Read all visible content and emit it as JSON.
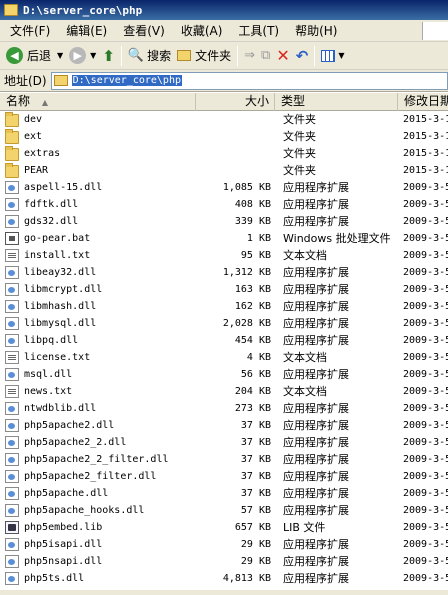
{
  "window": {
    "title": "D:\\server_core\\php"
  },
  "menu": [
    {
      "label": "文件(F)",
      "name": "menu-file"
    },
    {
      "label": "编辑(E)",
      "name": "menu-edit"
    },
    {
      "label": "查看(V)",
      "name": "menu-view"
    },
    {
      "label": "收藏(A)",
      "name": "menu-favorites"
    },
    {
      "label": "工具(T)",
      "name": "menu-tools"
    },
    {
      "label": "帮助(H)",
      "name": "menu-help"
    }
  ],
  "toolbar": {
    "back_label": "后退",
    "search_label": "搜索",
    "folders_label": "文件夹"
  },
  "address": {
    "label": "地址(D)",
    "value": "D:\\server_core\\php"
  },
  "columns": {
    "name": "名称",
    "size": "大小",
    "type": "类型",
    "modified": "修改日期"
  },
  "files": [
    {
      "name": "dev",
      "size": "",
      "type": "文件夹",
      "date": "2015-3-1",
      "icon": "folder"
    },
    {
      "name": "ext",
      "size": "",
      "type": "文件夹",
      "date": "2015-3-1",
      "icon": "folder"
    },
    {
      "name": "extras",
      "size": "",
      "type": "文件夹",
      "date": "2015-3-1",
      "icon": "folder"
    },
    {
      "name": "PEAR",
      "size": "",
      "type": "文件夹",
      "date": "2015-3-1",
      "icon": "folder"
    },
    {
      "name": "aspell-15.dll",
      "size": "1,085 KB",
      "type": "应用程序扩展",
      "date": "2009-3-5",
      "icon": "dll"
    },
    {
      "name": "fdftk.dll",
      "size": "408 KB",
      "type": "应用程序扩展",
      "date": "2009-3-5",
      "icon": "dll"
    },
    {
      "name": "gds32.dll",
      "size": "339 KB",
      "type": "应用程序扩展",
      "date": "2009-3-5",
      "icon": "dll"
    },
    {
      "name": "go-pear.bat",
      "size": "1 KB",
      "type": "Windows 批处理文件",
      "date": "2009-3-5",
      "icon": "bat"
    },
    {
      "name": "install.txt",
      "size": "95 KB",
      "type": "文本文档",
      "date": "2009-3-5",
      "icon": "txt"
    },
    {
      "name": "libeay32.dll",
      "size": "1,312 KB",
      "type": "应用程序扩展",
      "date": "2009-3-5",
      "icon": "dll"
    },
    {
      "name": "libmcrypt.dll",
      "size": "163 KB",
      "type": "应用程序扩展",
      "date": "2009-3-5",
      "icon": "dll"
    },
    {
      "name": "libmhash.dll",
      "size": "162 KB",
      "type": "应用程序扩展",
      "date": "2009-3-5",
      "icon": "dll"
    },
    {
      "name": "libmysql.dll",
      "size": "2,028 KB",
      "type": "应用程序扩展",
      "date": "2009-3-5",
      "icon": "dll"
    },
    {
      "name": "libpq.dll",
      "size": "454 KB",
      "type": "应用程序扩展",
      "date": "2009-3-5",
      "icon": "dll"
    },
    {
      "name": "license.txt",
      "size": "4 KB",
      "type": "文本文档",
      "date": "2009-3-5",
      "icon": "txt"
    },
    {
      "name": "msql.dll",
      "size": "56 KB",
      "type": "应用程序扩展",
      "date": "2009-3-5",
      "icon": "dll"
    },
    {
      "name": "news.txt",
      "size": "204 KB",
      "type": "文本文档",
      "date": "2009-3-5",
      "icon": "txt"
    },
    {
      "name": "ntwdblib.dll",
      "size": "273 KB",
      "type": "应用程序扩展",
      "date": "2009-3-5",
      "icon": "dll"
    },
    {
      "name": "php5apache2.dll",
      "size": "37 KB",
      "type": "应用程序扩展",
      "date": "2009-3-5",
      "icon": "dll"
    },
    {
      "name": "php5apache2_2.dll",
      "size": "37 KB",
      "type": "应用程序扩展",
      "date": "2009-3-5",
      "icon": "dll"
    },
    {
      "name": "php5apache2_2_filter.dll",
      "size": "37 KB",
      "type": "应用程序扩展",
      "date": "2009-3-5",
      "icon": "dll"
    },
    {
      "name": "php5apache2_filter.dll",
      "size": "37 KB",
      "type": "应用程序扩展",
      "date": "2009-3-5",
      "icon": "dll"
    },
    {
      "name": "php5apache.dll",
      "size": "37 KB",
      "type": "应用程序扩展",
      "date": "2009-3-5",
      "icon": "dll"
    },
    {
      "name": "php5apache_hooks.dll",
      "size": "57 KB",
      "type": "应用程序扩展",
      "date": "2009-3-5",
      "icon": "dll"
    },
    {
      "name": "php5embed.lib",
      "size": "657 KB",
      "type": "LIB 文件",
      "date": "2009-3-5",
      "icon": "lib"
    },
    {
      "name": "php5isapi.dll",
      "size": "29 KB",
      "type": "应用程序扩展",
      "date": "2009-3-5",
      "icon": "dll"
    },
    {
      "name": "php5nsapi.dll",
      "size": "29 KB",
      "type": "应用程序扩展",
      "date": "2009-3-5",
      "icon": "dll"
    },
    {
      "name": "php5ts.dll",
      "size": "4,813 KB",
      "type": "应用程序扩展",
      "date": "2009-3-5",
      "icon": "dll"
    }
  ]
}
